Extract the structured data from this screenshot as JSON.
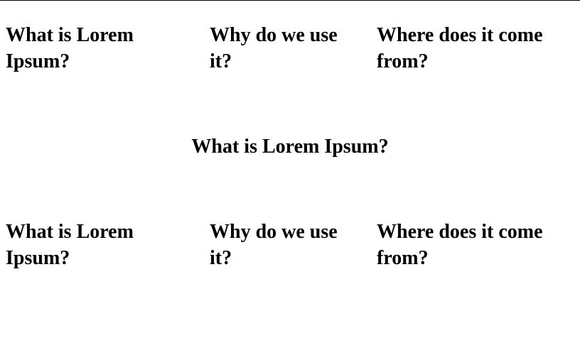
{
  "top_row": {
    "col1": "What is Lorem Ipsum?",
    "col2": "Why do we use it?",
    "col3": "Where does it come from?"
  },
  "center": {
    "heading": "What is Lorem Ipsum?"
  },
  "bottom_row": {
    "col1": "What is Lorem Ipsum?",
    "col2": "Why do we use it?",
    "col3": "Where does it come from?"
  }
}
